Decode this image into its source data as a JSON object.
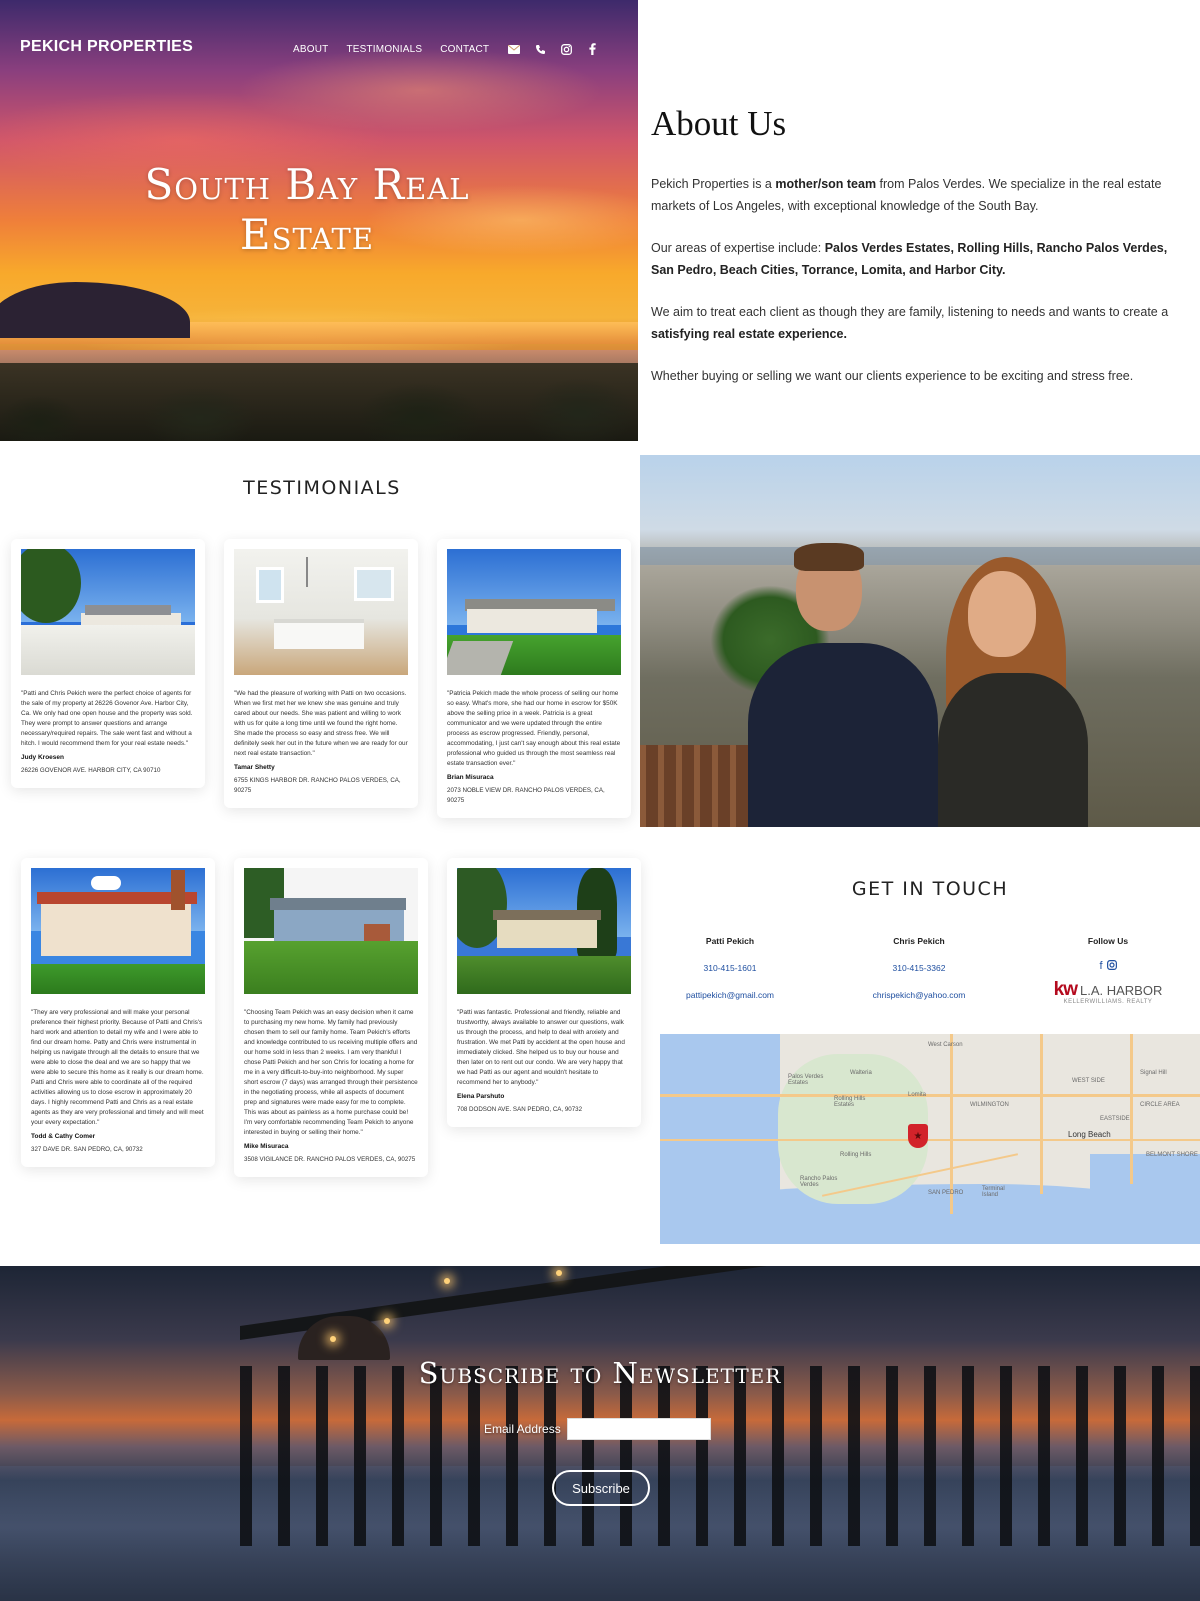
{
  "header": {
    "brand": "PEKICH PROPERTIES",
    "nav": [
      {
        "label": "ABOUT"
      },
      {
        "label": "TESTIMONIALS"
      },
      {
        "label": "CONTACT"
      }
    ],
    "icons": [
      "envelope-icon",
      "phone-icon",
      "instagram-icon",
      "facebook-icon"
    ]
  },
  "hero": {
    "title_line1": "South Bay Real",
    "title_line2": "Estate"
  },
  "about": {
    "title": "About Us",
    "p1_a": "Pekich Properties is a ",
    "p1_b": "mother/son team",
    "p1_c": " from Palos Verdes. We specialize in the real estate markets of Los Angeles, with exceptional knowledge of the South Bay.",
    "p2_a": "Our areas of expertise include: ",
    "p2_b": "Palos Verdes Estates, Rolling Hills, Rancho Palos Verdes, San Pedro, Beach Cities, Torrance, Lomita, and Harbor City.",
    "p3_a": "We aim to treat each client as though they are family, listening to needs and wants to create a ",
    "p3_b": "satisfying real estate experience.",
    "p4": "Whether buying or selling we want our clients experience to be exciting and stress free."
  },
  "testimonials": {
    "title": "TESTIMONIALS",
    "items": [
      {
        "quote": "\"Patti and Chris Pekich were the perfect choice of agents for the sale of my property at 26226 Govenor Ave. Harbor City, Ca. We only had one open house and the property was sold. They were prompt to answer questions and arrange necessary/required repairs. The sale went fast and without a hitch. I would recommend them for your real estate needs.\"",
        "name": "Judy Kroesen",
        "address": "26226 GOVENOR AVE. HARBOR CITY, CA 90710"
      },
      {
        "quote": "\"We had the pleasure of working with Patti on two occasions. When we first met her we knew she was genuine and truly cared about our needs. She was patient and willing to work with us for quite a long time until we found the right home. She made the process so easy and stress free. We will definitely seek her out in the future when we are ready for our next real estate transaction.\"",
        "name": "Tamar Shetty",
        "address": "6755 KINGS HARBOR DR. RANCHO PALOS VERDES, CA, 90275"
      },
      {
        "quote": "\"Patricia Pekich made the whole process of selling our home so easy. What's more, she had our home in escrow for $50K above the selling price in a week. Patricia is a great communicator and we were updated through the entire process as escrow progressed. Friendly, personal, accommodating, I just can't say enough about this real estate professional who guided us through the most seamless real estate transaction ever.\"",
        "name": "Brian Misuraca",
        "address": "2073 NOBLE VIEW DR. RANCHO PALOS VERDES, CA, 90275"
      },
      {
        "quote": "\"They are very professional and will make your personal preference their highest priority. Because of Patti and Chris's hard work and attention to detail my wife and I were able to find our dream home. Patty and Chris were instrumental in helping us navigate through all the details to ensure that we were able to close the deal and we are so happy that we were able to secure this home as it really is our dream home. Patti and Chris were able to coordinate all of the required activities allowing us to close escrow in approximately 20 days. I highly recommend Patti and Chris as a real estate agents as they are very professional and timely and will meet your every expectation.\"",
        "name": "Todd & Cathy Comer",
        "address": "327 DAVE DR. SAN PEDRO, CA, 90732"
      },
      {
        "quote": "\"Choosing Team Pekich was an easy decision when it came to purchasing my new home. My family had previously chosen them to sell our family home. Team Pekich's efforts and knowledge contributed to us receiving multiple offers and our home sold in less than 2 weeks. I am very thankful I chose Patti Pekich and her son Chris for locating a home for me in a very difficult-to-buy-into neighborhood. My super short escrow (7 days) was arranged through their persistence in the negotiating process, while all aspects of document prep and signatures were made easy for me to complete. This was about as painless as a home purchase could be! I'm very comfortable recommending Team Pekich to anyone interested in buying or selling their home.\"",
        "name": "Mike Misuraca",
        "address": "3508 VIGILANCE DR. RANCHO PALOS VERDES, CA, 90275"
      },
      {
        "quote": "\"Patti was fantastic. Professional and friendly, reliable and trustworthy, always available to answer our questions, walk us through the process, and help to deal with anxiety and frustration. We met Patti by accident at the open house and immediately clicked. She helped us to buy our house and then later on to rent out our condo. We are very happy that we had Patti as our agent and wouldn't hesitate to recommend her to anybody.\"",
        "name": "Elena Parshuto",
        "address": "708 DODSON AVE. SAN PEDRO, CA, 90732"
      }
    ]
  },
  "contact": {
    "title": "GET IN TOUCH",
    "patti": {
      "name": "Patti Pekich",
      "phone": "310-415-1601",
      "email": "pattipekich@gmail.com"
    },
    "chris": {
      "name": "Chris Pekich",
      "phone": "310-415-3362",
      "email": "chrispekich@yahoo.com"
    },
    "follow": {
      "label": "Follow Us",
      "logo_k": "kw",
      "logo_text": "L.A. HARBOR",
      "logo_sub": "KELLERWILLIAMS. REALTY"
    }
  },
  "map": {
    "labels": [
      "West Carson",
      "Walteria",
      "Palos Verdes Estates",
      "Lomita",
      "Rolling Hills Estates",
      "Signal Hill",
      "Long Beach",
      "Rolling Hills",
      "Rancho Palos Verdes",
      "Terminal Island",
      "WILMINGTON",
      "SAN PEDRO",
      "EASTSIDE",
      "CIRCLE AREA",
      "BELMONT SHORE",
      "WEST SIDE"
    ]
  },
  "newsletter": {
    "title": "Subscribe to Newsletter",
    "email_label": "Email Address",
    "email_value": "",
    "button": "Subscribe"
  },
  "colors": {
    "link": "#1f4fa0",
    "kw_red": "#b40a1e"
  }
}
